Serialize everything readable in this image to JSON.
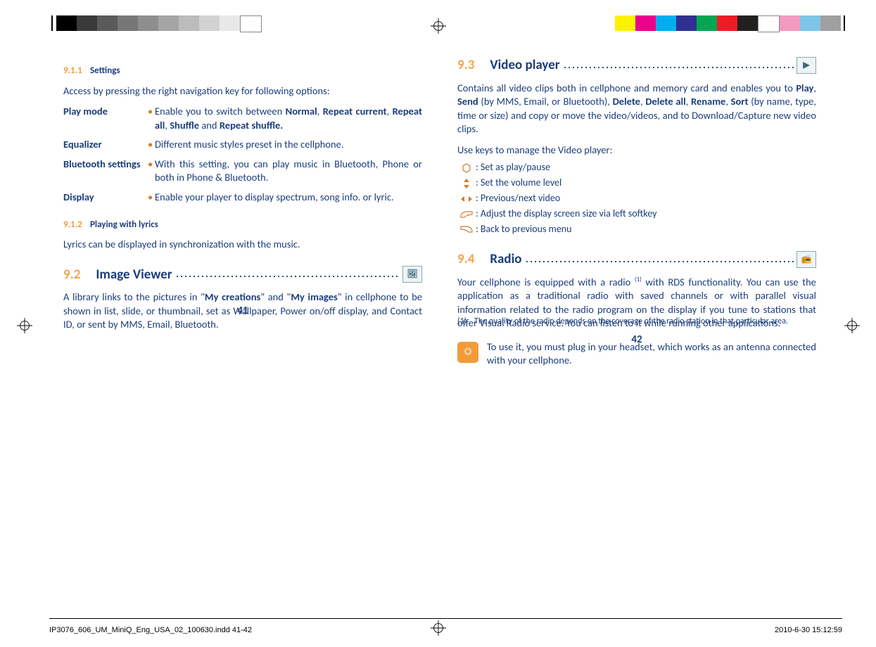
{
  "left": {
    "s911": {
      "num": "9.1.1",
      "title": "Settings"
    },
    "s911_intro": "Access by pressing the right navigation key for following options:",
    "opts": [
      {
        "k": "Play mode",
        "v": "Enable you to switch between <b>Normal</b>, <b>Repeat current</b>, <b>Repeat all</b>, <b>Shuffle</b> and <b>Repeat shuffle.</b>"
      },
      {
        "k": "Equalizer",
        "v": "Different music styles preset in the cellphone."
      },
      {
        "k": "Bluetooth settings",
        "v": "With this setting, you can play music in Bluetooth, Phone or both in Phone & Bluetooth."
      },
      {
        "k": "Display",
        "v": "Enable your player to display spectrum, song info. or lyric."
      }
    ],
    "s912": {
      "num": "9.1.2",
      "title": "Playing with lyrics"
    },
    "s912_body": "Lyrics can be displayed in synchronization with the music.",
    "s92": {
      "num": "9.2",
      "title": "Image Viewer"
    },
    "s92_body": "A library links to the pictures in \"<b>My creations</b>\" and \"<b>My images</b>\" in cellphone to be shown in list, slide, or thumbnail, set as Wallpaper, Power on/off display, and Contact ID, or sent by MMS, Email, Bluetooth.",
    "page_num": "41"
  },
  "right": {
    "s93": {
      "num": "9.3",
      "title": "Video player"
    },
    "s93_body": "Contains all video clips both in cellphone and memory card and enables you to <b>Play</b>, <b>Send</b> (by MMS, Email, or Bluetooth), <b>Delete</b>, <b>Delete all</b>, <b>Rename</b>, <b>Sort</b> (by name, type, time or size) and copy or move the video/videos, and to Download/Capture new video clips.",
    "s93_keys_intro": "Use keys to manage the Video player:",
    "keys": [
      {
        "icon": "hex",
        "txt": ": Set as play/pause"
      },
      {
        "icon": "updown",
        "txt": ": Set the volume level"
      },
      {
        "icon": "lr",
        "txt": ": Previous/next video"
      },
      {
        "icon": "lsk",
        "txt": ": Adjust the display screen size via left softkey"
      },
      {
        "icon": "rsk",
        "txt": ": Back to previous menu"
      }
    ],
    "s94": {
      "num": "9.4",
      "title": "Radio"
    },
    "s94_body": "Your cellphone is equipped with a radio <sup>(1)</sup> with RDS functionality. You can use the application as a traditional radio with saved channels or with parallel visual information related to the radio program on the display if you tune to stations that offer Visual Radio service. You can listen to it while running other applications.",
    "tip": "To use it, you must plug in your headset, which works as an antenna connected with your cellphone.",
    "footnote_mark": "(1)",
    "footnote_text": "The quality of the radio depends on the coverage of the radio station in that particular area.",
    "page_num": "42"
  },
  "footer": {
    "file": "IP3076_606_UM_MiniQ_Eng_USA_02_100630.indd   41-42",
    "stamp": "2010-6-30   15:12:59"
  },
  "colorbar_left": [
    "#000",
    "#3a3a3a",
    "#5a5a5a",
    "#777",
    "#8e8e8e",
    "#a5a5a5",
    "#bcbcbc",
    "#d2d2d2",
    "#e8e8e8",
    "#fff"
  ],
  "colorbar_right": [
    "#fff200",
    "#ec008c",
    "#00aeef",
    "#2e3192",
    "#00a651",
    "#ed1c24",
    "#231f20",
    "#fff",
    "#f49ac1",
    "#7cc7e8",
    "#a0a0a0"
  ]
}
